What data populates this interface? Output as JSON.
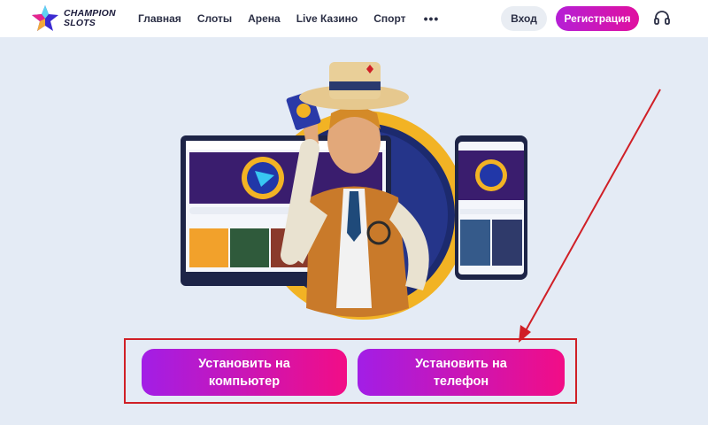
{
  "header": {
    "logo_line1": "CHAMPION",
    "logo_line2": "SLOTS",
    "nav": [
      "Главная",
      "Слоты",
      "Арена",
      "Live Казино",
      "Спорт"
    ],
    "more_label": "•••",
    "login_label": "Вход",
    "register_label": "Регистрация"
  },
  "install": {
    "pc_label": "Установить на компьютер",
    "phone_label": "Установить на телефон"
  },
  "colors": {
    "accent_gradient_start": "#a21ee6",
    "accent_gradient_end": "#f20d86",
    "highlight_border": "#d01f26",
    "background": "#e4ebf5"
  }
}
